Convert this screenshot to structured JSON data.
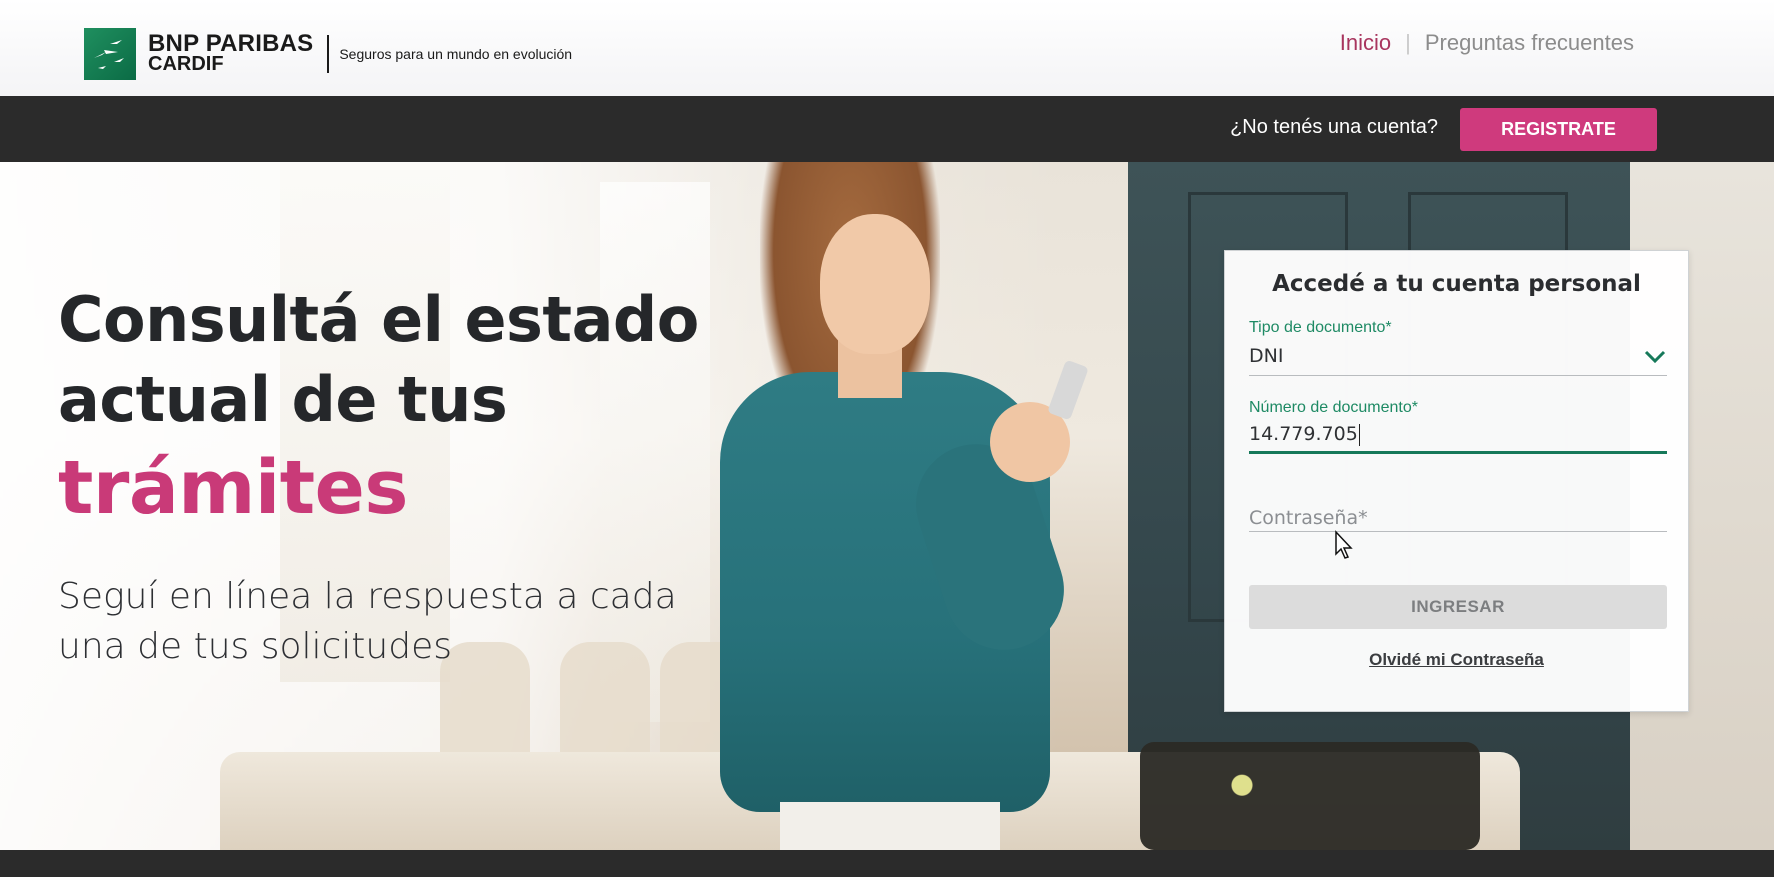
{
  "header": {
    "brand_line1": "BNP PARIBAS",
    "brand_line2": "CARDIF",
    "tagline": "Seguros para un mundo en evolución",
    "nav": {
      "inicio": "Inicio",
      "separator": "|",
      "faq": "Preguntas frecuentes"
    }
  },
  "account_bar": {
    "question": "¿No tenés una cuenta?",
    "register_label": "REGISTRATE"
  },
  "hero": {
    "headline_line1": "Consultá el estado",
    "headline_line2": "actual de tus",
    "headline_accent": "trámites",
    "subheadline": "Seguí en línea la respuesta a cada una de tus solicitudes"
  },
  "login": {
    "title": "Accedé a tu cuenta personal",
    "doc_type_label": "Tipo de documento*",
    "doc_type_value": "DNI",
    "doc_number_label": "Número de documento*",
    "doc_number_value": "14.779.705",
    "password_placeholder": "Contraseña*",
    "submit_label": "INGRESAR",
    "forgot_label": "Olvidé mi Contraseña"
  },
  "colors": {
    "accent_pink": "#cf3a7d",
    "accent_green": "#16795a",
    "dark_bar": "#2b2b2b"
  },
  "icons": [
    "bnp-paribas-logo-icon",
    "chevron-down-icon",
    "mouse-pointer-icon"
  ]
}
